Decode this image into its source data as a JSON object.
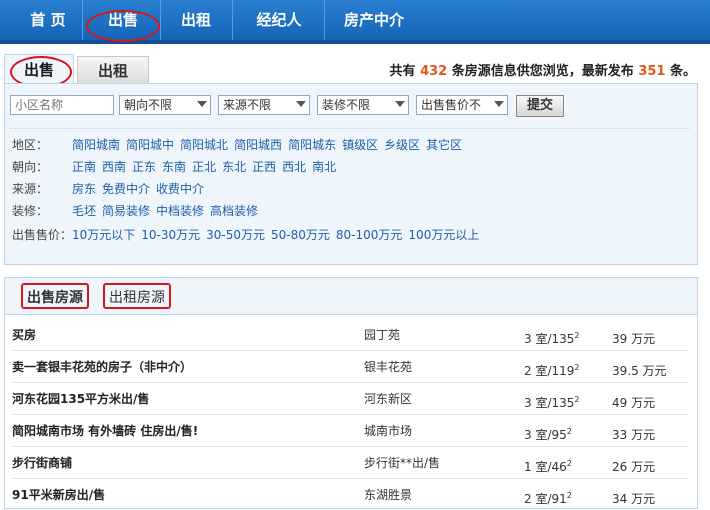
{
  "nav": {
    "items": [
      {
        "label": "首 页"
      },
      {
        "label": "出售"
      },
      {
        "label": "出租"
      },
      {
        "label": "经纪人"
      },
      {
        "label": "房产中介"
      }
    ]
  },
  "tabs": {
    "sell": "出售",
    "rent": "出租"
  },
  "stats": {
    "prefix": "共有",
    "count": "432",
    "middle": "条房源信息供您浏览，最新发布",
    "latest": "351",
    "suffix": "条。"
  },
  "search": {
    "community_placeholder": "小区名称",
    "orientation": "朝向不限",
    "source": "来源不限",
    "decoration": "装修不限",
    "price": "出售售价不",
    "submit": "提交"
  },
  "filters": [
    {
      "label": "地区：",
      "options": [
        "简阳城南",
        "简阳城中",
        "简阳城北",
        "简阳城西",
        "简阳城东",
        "镇级区",
        "乡级区",
        "其它区"
      ]
    },
    {
      "label": "朝向：",
      "options": [
        "正南",
        "西南",
        "正东",
        "东南",
        "正北",
        "东北",
        "正西",
        "西北",
        "南北"
      ]
    },
    {
      "label": "来源：",
      "options": [
        "房东",
        "免费中介",
        "收费中介"
      ]
    },
    {
      "label": "装修：",
      "options": [
        "毛坯",
        "简易装修",
        "中档装修",
        "高档装修"
      ]
    },
    {
      "label": "出售售价：",
      "options": [
        "10万元以下",
        "10-30万元",
        "30-50万元",
        "50-80万元",
        "80-100万元",
        "100万元以上"
      ]
    }
  ],
  "listing_tabs": {
    "sell": "出售房源",
    "rent": "出租房源"
  },
  "listings": [
    {
      "title": "买房",
      "community": "园丁苑",
      "rooms": "3 室/135",
      "price": "39 万元"
    },
    {
      "title": "卖一套银丰花苑的房子（非中介）",
      "community": "银丰花苑",
      "rooms": "2 室/119",
      "price": "39.5 万元"
    },
    {
      "title": "河东花园135平方米出/售",
      "community": "河东新区",
      "rooms": "3 室/135",
      "price": "49 万元"
    },
    {
      "title": "简阳城南市场 有外墙砖 住房出/售!",
      "community": "城南市场",
      "rooms": "3 室/95",
      "price": "33 万元"
    },
    {
      "title": "步行街商铺",
      "community": "步行街**出/售",
      "rooms": "1 室/46",
      "price": "26 万元"
    },
    {
      "title": "91平米新房出/售",
      "community": "东湖胜景",
      "rooms": "2 室/91",
      "price": "34 万元"
    }
  ],
  "area_unit_sup": "2"
}
